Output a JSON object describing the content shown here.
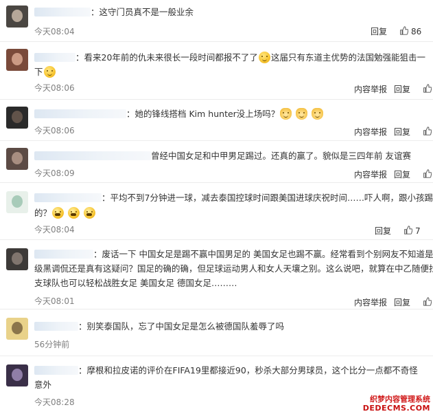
{
  "actions": {
    "reply": "回复",
    "report": "内容举报"
  },
  "comments": [
    {
      "lines": [
        "这守门员真不是一般业余"
      ],
      "time": "今天08:04",
      "likes": "86",
      "show_report": false
    },
    {
      "lines": [
        "看来20年前的仇未来很长一段时间都报不了了",
        "这届只有东道主优势的法国勉强能狙击一",
        "下"
      ],
      "time": "今天08:06",
      "likes": "19",
      "show_report": true
    },
    {
      "lines": [
        "她的锋线搭档 Kim hunter没上场吗？"
      ],
      "time": "今天08:06",
      "likes": "14",
      "show_report": true
    },
    {
      "lines": [
        "曾经中国女足和中甲男足踢过。还真的赢了。貌似是三四年前 友谊赛"
      ],
      "time": "今天08:09",
      "likes": "15",
      "show_report": true
    },
    {
      "lines": [
        "平均不到7分钟进一球，减去泰国控球时间跟美国进球庆祝时间……吓人啊，跟小孩踢",
        "的？"
      ],
      "time": "今天08:04",
      "likes": "7",
      "show_report": false
    },
    {
      "lines": [
        "废话一下 中国女足是踢不赢中国男足的 美国女足也踢不赢。经常看到个别网友不知道是高",
        "级黑调侃还是真有这疑问？国足的确的确，但足球运动男人和女人天壤之别。这么说吧，就算在中乙随便找",
        "支球队也可以轻松战胜女足 美国女足 德国女足………"
      ],
      "time": "今天08:01",
      "likes": "12",
      "show_report": true
    },
    {
      "lines": [
        "别笑泰国队，忘了中国女足是怎么被德国队羞辱了吗"
      ],
      "time": "56分钟前",
      "likes": "",
      "show_report": false
    },
    {
      "lines": [
        "摩根和拉皮诺的评价在FIFA19里都接近90，秒杀大部分男球员，这个比分一点都不奇怪",
        "意外"
      ],
      "time": "今天08:28",
      "likes": "",
      "show_report": true
    }
  ],
  "watermark": {
    "line1": "织梦内容管理系统",
    "line2": "DEDECMS.COM"
  },
  "colors": {
    "link": "#333333",
    "time": "#808080",
    "watermark": "#d01818"
  },
  "icons": {
    "like": "thumbs-up-icon",
    "emoji_smile": "smile-emoji-icon",
    "emoji_cat": "cat-emoji-icon",
    "emoji_laugh_cry": "laugh-cry-emoji-icon"
  }
}
